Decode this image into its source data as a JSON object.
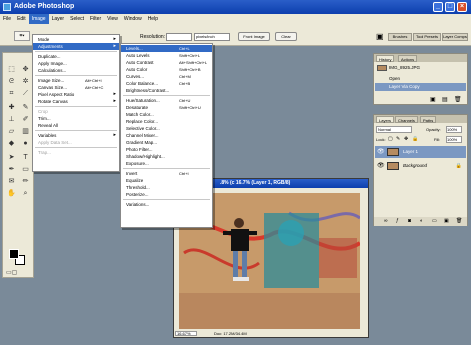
{
  "window": {
    "title": "Adobe Photoshop"
  },
  "menubar": [
    "File",
    "Edit",
    "Image",
    "Layer",
    "Select",
    "Filter",
    "View",
    "Window",
    "Help"
  ],
  "options": {
    "resolution_label": "Resolution:",
    "units_value": "pixels/inch",
    "front_image": "Front Image",
    "clear": "Clear",
    "palette_tabs": [
      "Brushes",
      "Tool Presets",
      "Layer Comps"
    ]
  },
  "image_menu": [
    {
      "label": "Mode",
      "sub": true
    },
    {
      "label": "Adjustments",
      "sub": true,
      "hl": true
    },
    {
      "label": "Duplicate..."
    },
    {
      "label": "Apply Image..."
    },
    {
      "label": "Calculations..."
    },
    {
      "label": "Image Size...",
      "sc": "Alt+Ctrl+I"
    },
    {
      "label": "Canvas Size...",
      "sc": "Alt+Ctrl+C"
    },
    {
      "label": "Pixel Aspect Ratio",
      "sub": true
    },
    {
      "label": "Rotate Canvas",
      "sub": true
    },
    {
      "label": "Crop",
      "dis": true
    },
    {
      "label": "Trim..."
    },
    {
      "label": "Reveal All"
    },
    {
      "label": "Variables",
      "sub": true
    },
    {
      "label": "Apply Data Set...",
      "dis": true
    },
    {
      "label": "Trap...",
      "dis": true
    }
  ],
  "adjust_menu": [
    {
      "label": "Levels...",
      "sc": "Ctrl+L",
      "hl": true
    },
    {
      "label": "Auto Levels",
      "sc": "Shift+Ctrl+L"
    },
    {
      "label": "Auto Contrast",
      "sc": "Alt+Shift+Ctrl+L"
    },
    {
      "label": "Auto Color",
      "sc": "Shift+Ctrl+B"
    },
    {
      "label": "Curves...",
      "sc": "Ctrl+M"
    },
    {
      "label": "Color Balance...",
      "sc": "Ctrl+B"
    },
    {
      "label": "Brightness/Contrast..."
    },
    {
      "label": "Hue/Saturation...",
      "sc": "Ctrl+U"
    },
    {
      "label": "Desaturate",
      "sc": "Shift+Ctrl+U"
    },
    {
      "label": "Match Color..."
    },
    {
      "label": "Replace Color..."
    },
    {
      "label": "Selective Color..."
    },
    {
      "label": "Channel Mixer..."
    },
    {
      "label": "Gradient Map..."
    },
    {
      "label": "Photo Filter..."
    },
    {
      "label": "Shadow/Highlight..."
    },
    {
      "label": "Exposure..."
    },
    {
      "label": "Invert",
      "sc": "Ctrl+I"
    },
    {
      "label": "Equalize"
    },
    {
      "label": "Threshold..."
    },
    {
      "label": "Posterize..."
    },
    {
      "label": "Variations..."
    }
  ],
  "document": {
    "title": ".8% (c 16.7% (Layer 1, RGB/8)",
    "zoom": "16.67%",
    "doc_size": "Doc: 17.2M/34.4M"
  },
  "history": {
    "tabs": [
      "History",
      "Actions"
    ],
    "snapshot": "IMG_8925.JPG",
    "items": [
      "Open",
      "Layer Via Copy"
    ]
  },
  "layers": {
    "tabs": [
      "Layers",
      "Channels",
      "Paths"
    ],
    "blend": "Normal",
    "opacity_label": "Opacity:",
    "opacity": "100%",
    "lock_label": "Lock:",
    "fill_label": "Fill:",
    "fill": "100%",
    "items": [
      "Layer 1",
      "Background"
    ]
  },
  "colors": {
    "titlebar": "#0d3fae",
    "highlight": "#316ac5",
    "workspace": "#7a8a99"
  }
}
